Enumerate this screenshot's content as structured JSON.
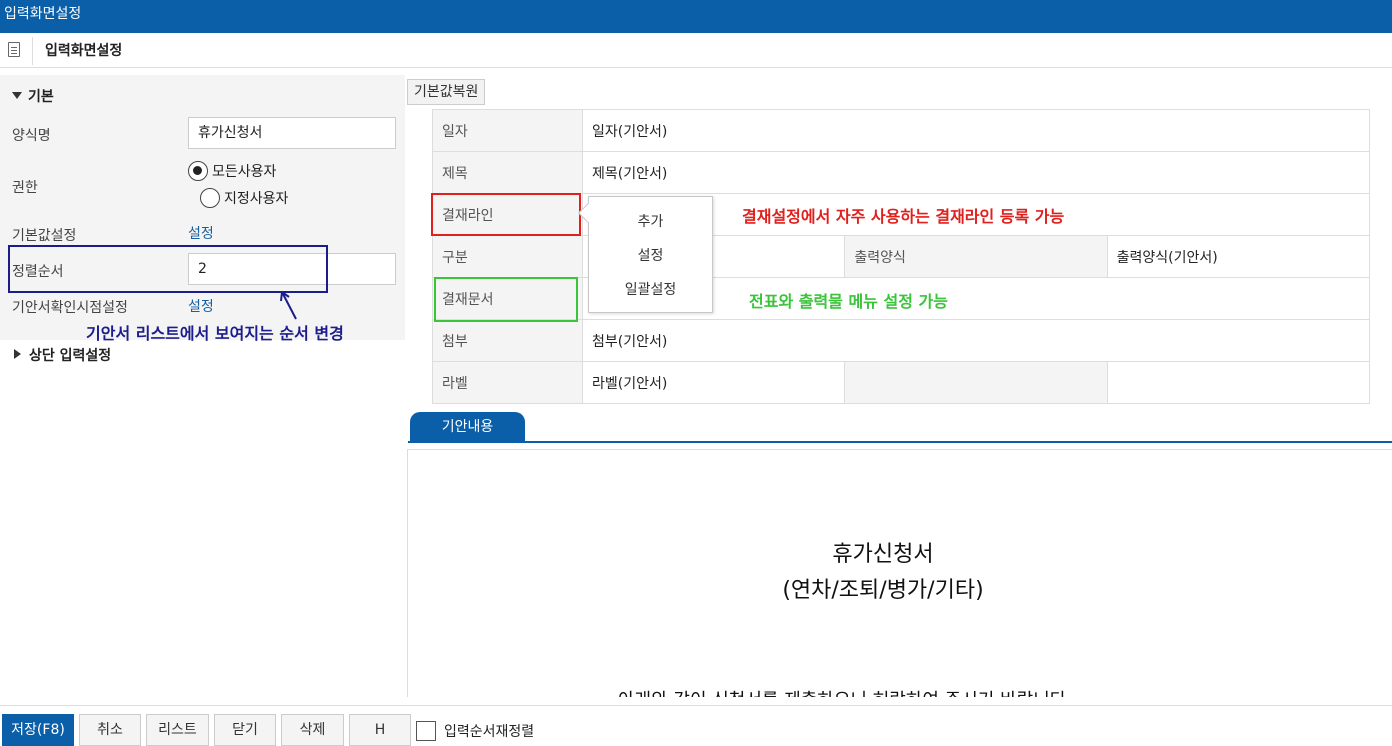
{
  "window": {
    "title": "입력화면설정"
  },
  "header": {
    "title": "입력화면설정"
  },
  "left": {
    "section_basic": "기본",
    "form_name_label": "양식명",
    "form_name_value": "휴가신청서",
    "permission_label": "권한",
    "radio_all": "모든사용자",
    "radio_specific": "지정사용자",
    "radio_selected": "모든사용자",
    "default_label": "기본값설정",
    "default_link": "설정",
    "sort_label": "정렬순서",
    "sort_value": "2",
    "confirm_label": "기안서확인시점설정",
    "confirm_link": "설정",
    "section_top": "상단 입력설정"
  },
  "restore_button": "기본값복원",
  "form_rows": [
    {
      "label": "일자",
      "value": "일자(기안서)"
    },
    {
      "label": "제목",
      "value": "제목(기안서)"
    },
    {
      "label": "결재라인",
      "value": ""
    },
    {
      "label": "구분",
      "value": "",
      "label2": "출력양식",
      "value2": "출력양식(기안서)"
    },
    {
      "label": "결재문서",
      "value": ""
    },
    {
      "label": "첨부",
      "value": "첨부(기안서)"
    },
    {
      "label": "라벨",
      "value": "라벨(기안서)"
    }
  ],
  "popup": {
    "items": [
      "추가",
      "설정",
      "일괄설정"
    ]
  },
  "annotations": {
    "blue": "기안서 리스트에서 보여지는 순서 변경",
    "red": "결재설정에서 자주 사용하는 결재라인 등록 가능",
    "green": "전표와 출력물 메뉴 설정 가능",
    "colors": {
      "blue": "#1c1c8c",
      "red": "#e0201c",
      "green": "#3ac43a"
    }
  },
  "editor": {
    "tab": "기안내용",
    "doc_title_line1": "휴가신청서",
    "doc_title_line2": "(연차/조퇴/병가/기타)",
    "doc_cut_line": "아래와 같이 신청서를 제출하오니 허락하여 주시기 바랍니다"
  },
  "footer": {
    "save": "저장(F8)",
    "cancel": "취소",
    "list": "리스트",
    "close": "닫기",
    "delete": "삭제",
    "h": "H",
    "reorder_label": "입력순서재정렬"
  },
  "accent_color": "#0b5ea8"
}
